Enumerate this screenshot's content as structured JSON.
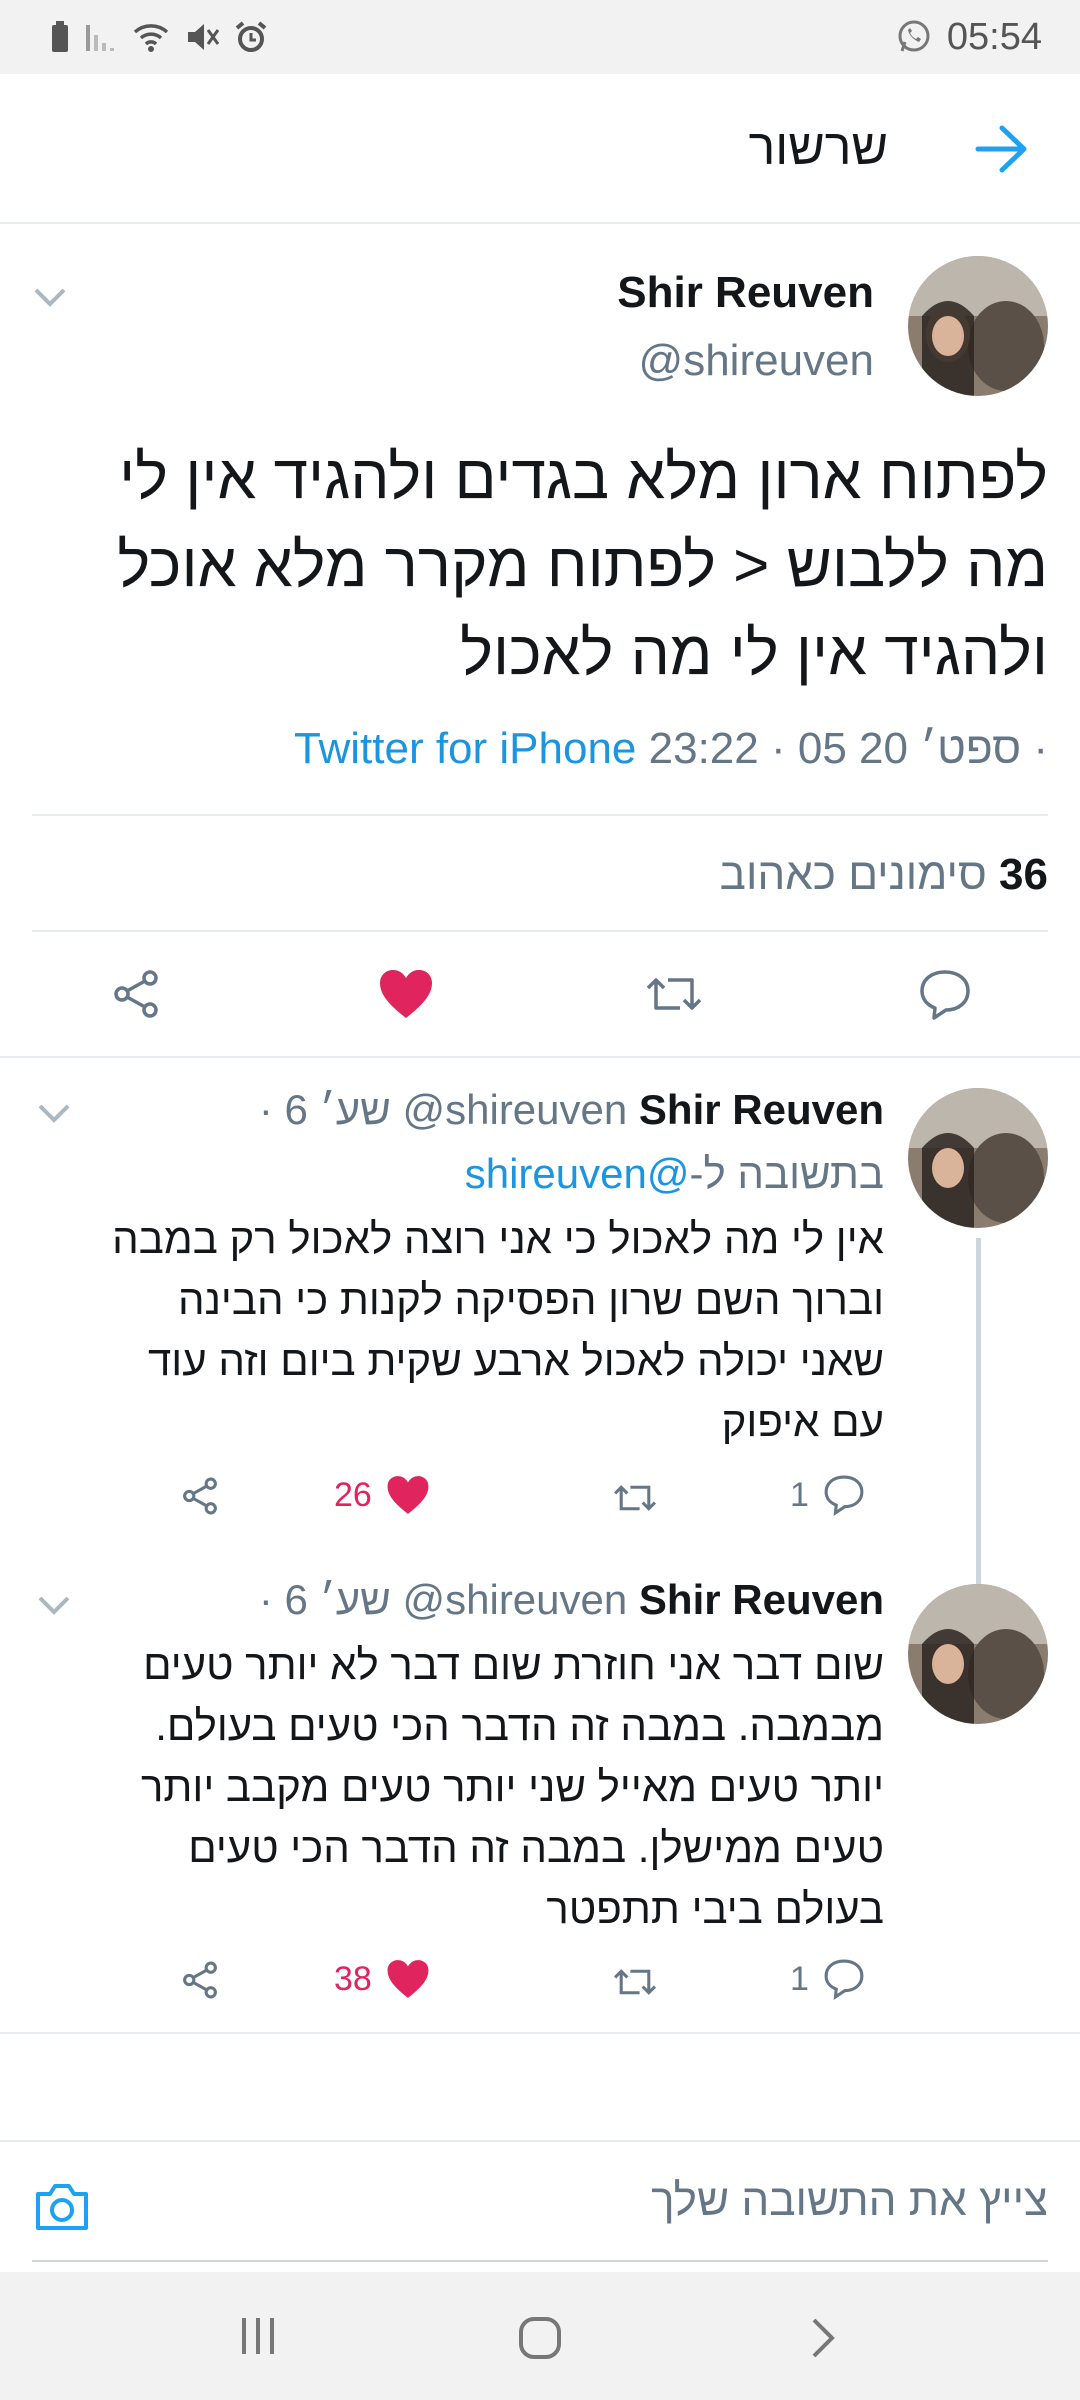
{
  "status_bar": {
    "time": "05:54",
    "icons": [
      "battery-icon",
      "signal-icon",
      "wifi-icon",
      "mute-icon",
      "alarm-icon",
      "whatsapp-icon"
    ]
  },
  "app_bar": {
    "title": "שרשור",
    "back_icon": "arrow-right-icon"
  },
  "main_tweet": {
    "name": "Shir Reuven",
    "handle": "@shireuven",
    "text_lines": [
      "לפתוח ארון מלא בגדים ולהגיד אין לי",
      "מה ללבוש < לפתוח מקרר מלא אוכל",
      "ולהגיד אין לי מה לאכול"
    ],
    "time": "23:22 · 05 ספט׳ 20 · ",
    "source": "Twitter for iPhone",
    "likes_count": "36",
    "likes_label": "סימונים כאהוב"
  },
  "replies": [
    {
      "name": "Shir Reuven",
      "handle": "@shireuven",
      "time": "· 6 שע׳",
      "reply_prefix": "בתשובה ל-",
      "reply_to": "@shireuven",
      "text_lines": [
        "אין לי מה לאכול כי אני רוצה לאכול רק במבה",
        "וברוך השם שרון הפסיקה לקנות כי הבינה",
        "שאני יכולה לאכול ארבע שקית ביום וזה עוד",
        "עם איפוק"
      ],
      "reply_count": "1",
      "like_count": "26"
    },
    {
      "name": "Shir Reuven",
      "handle": "@shireuven",
      "time": "· 6 שע׳",
      "text_lines": [
        "שום דבר אני חוזרת שום דבר לא יותר טעים",
        "מבמבה. במבה זה הדבר הכי טעים בעולם.",
        "יותר טעים מאייל שני יותר טעים מקבב יותר",
        "טעים ממישלן. במבה זה הדבר הכי טעים",
        "בעולם ביבי תתפטר"
      ],
      "reply_count": "1",
      "like_count": "38"
    }
  ],
  "compose": {
    "placeholder": "צייץ את התשובה שלך",
    "camera_icon": "camera-icon"
  },
  "colors": {
    "accent": "#1b95e0",
    "like": "#e0245e",
    "secondary_text": "#657786",
    "divider": "#e6ecf0"
  }
}
